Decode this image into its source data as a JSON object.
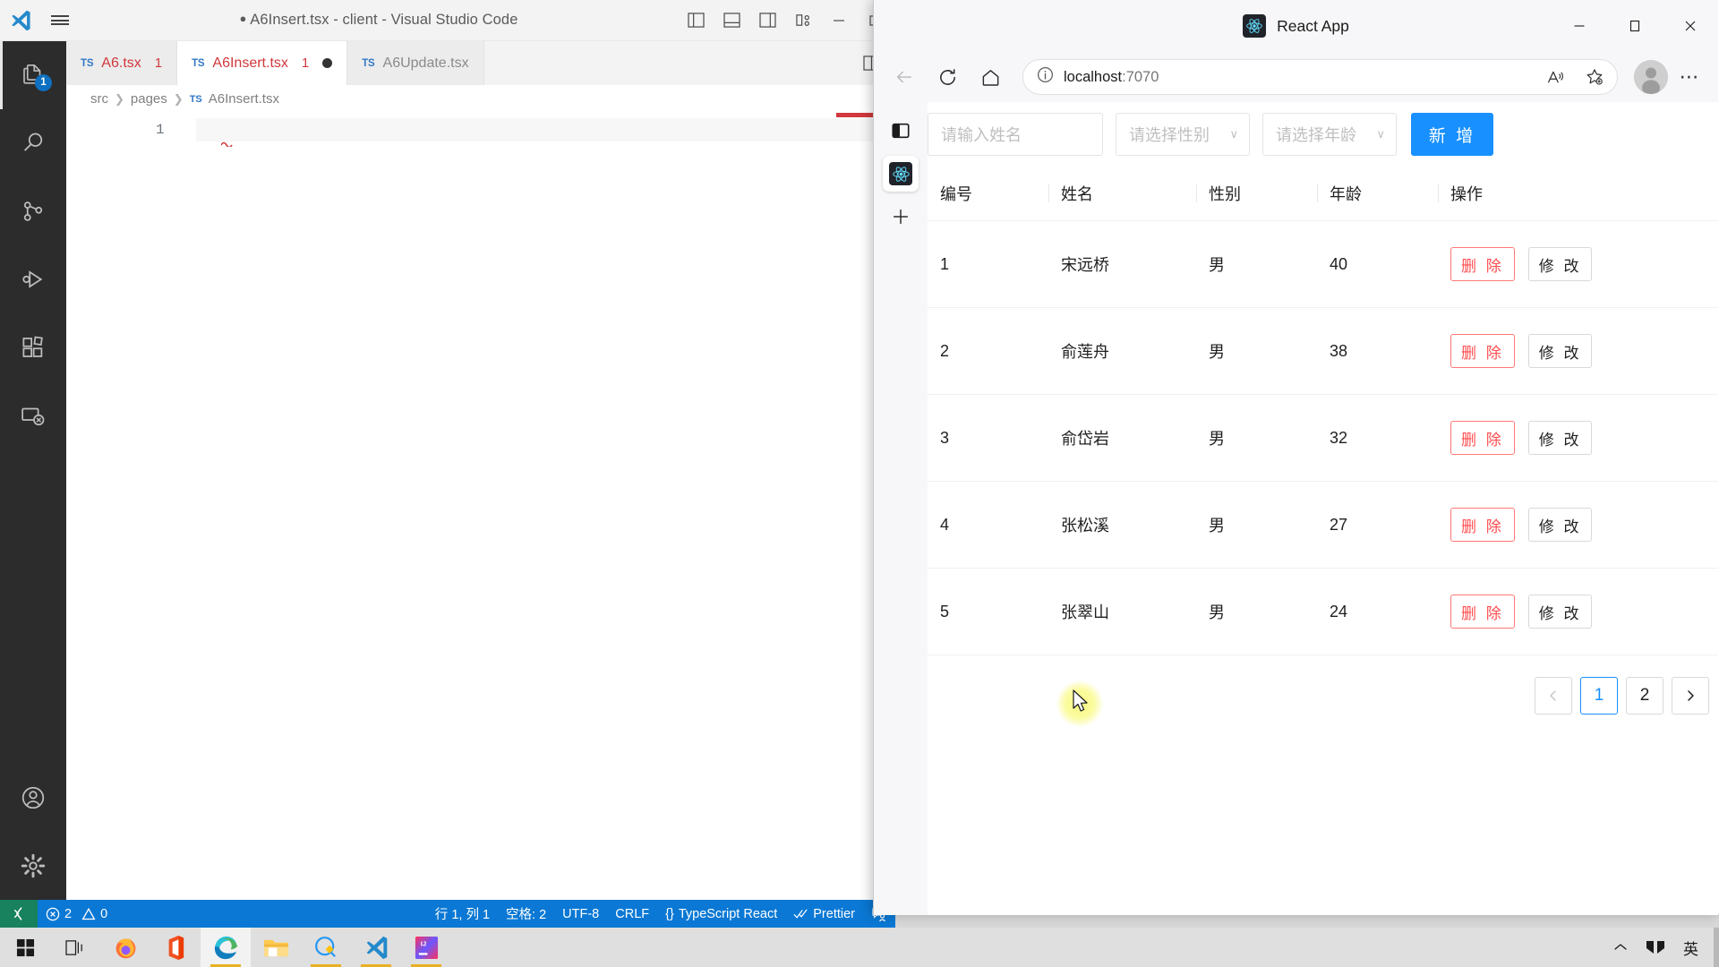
{
  "vscode": {
    "title_prefix": "●",
    "title": "A6Insert.tsx - client - Visual Studio Code",
    "logo_icon": "vscode-logo-icon",
    "menu_icon": "hamburger-menu-icon",
    "title_icons": [
      "toggle-primary-sidebar-icon",
      "toggle-panel-icon",
      "toggle-secondary-sidebar-icon",
      "customize-layout-icon"
    ],
    "window_buttons": [
      "minimize",
      "maximize",
      "close"
    ],
    "activity_bar": [
      {
        "name": "explorer",
        "icon": "files-icon",
        "badge": "1",
        "active": true
      },
      {
        "name": "search",
        "icon": "search-icon",
        "badge": "",
        "active": false
      },
      {
        "name": "source-control",
        "icon": "source-control-icon",
        "badge": "",
        "active": false
      },
      {
        "name": "run-and-debug",
        "icon": "run-debug-icon",
        "badge": "",
        "active": false
      },
      {
        "name": "extensions",
        "icon": "extensions-icon",
        "badge": "",
        "active": false
      },
      {
        "name": "remote-explorer",
        "icon": "remote-explorer-icon",
        "badge": "",
        "active": false
      }
    ],
    "activity_bottom": [
      {
        "name": "accounts",
        "icon": "account-icon"
      },
      {
        "name": "manage",
        "icon": "gear-icon"
      }
    ],
    "tabs": [
      {
        "ts_badge": "TS",
        "label": "A6.tsx",
        "error_count": "1",
        "modified": false,
        "active": false
      },
      {
        "ts_badge": "TS",
        "label": "A6Insert.tsx",
        "error_count": "1",
        "modified": true,
        "active": true
      },
      {
        "ts_badge": "TS",
        "label": "A6Update.tsx",
        "error_count": "",
        "modified": false,
        "active": false
      }
    ],
    "tabs_right_icon": "split-editor-icon",
    "breadcrumb": [
      "src",
      "pages",
      "A6Insert.tsx"
    ],
    "breadcrumb_ts_badge": "TS",
    "editor": {
      "line_number": "1",
      "content": ""
    },
    "status": {
      "remote_icon": "remote-window-icon",
      "errors_icon": "error-circle-icon",
      "errors": "2",
      "warnings_icon": "warning-triangle-icon",
      "warnings": "0",
      "cursor_position": "行 1, 列 1",
      "indentation": "空格: 2",
      "encoding": "UTF-8",
      "eol": "CRLF",
      "language_icon": "{}",
      "language": "TypeScript React",
      "formatter_icon": "checkmarks-icon",
      "formatter": "Prettier",
      "feedback_icon": "feedback-icon"
    }
  },
  "browser": {
    "tab_title": "React App",
    "favicon": "react-logo-icon",
    "window_buttons": {
      "minimize": "minimize-icon",
      "maximize": "maximize-icon",
      "close": "close-icon"
    },
    "nav": {
      "back_icon": "arrow-back-icon",
      "refresh_icon": "refresh-icon",
      "home_icon": "home-icon",
      "info_icon": "info-circle-icon",
      "url_host": "localhost",
      "url_port": ":7070",
      "read_aloud_icon": "read-aloud-icon",
      "favorite_icon": "add-favorite-star-icon",
      "profile_icon": "profile-avatar-icon",
      "settings_icon": "more-options-icon"
    },
    "sidebar": [
      {
        "name": "collapse-sidebar",
        "icon": "sidebar-panel-icon",
        "selected": false
      },
      {
        "name": "react-app-sidebar",
        "icon": "react-logo-icon",
        "selected": true
      },
      {
        "name": "add-sidebar-app",
        "icon": "plus-icon",
        "selected": false
      }
    ]
  },
  "app": {
    "form": {
      "name_placeholder": "请输入姓名",
      "gender_placeholder": "请选择性别",
      "age_placeholder": "请选择年龄",
      "add_button": "新 增",
      "caret_icon": "chevron-down-icon"
    },
    "table": {
      "columns": [
        "编号",
        "姓名",
        "性别",
        "年龄",
        "操作"
      ],
      "rows": [
        {
          "id": "1",
          "name": "宋远桥",
          "gender": "男",
          "age": "40",
          "delete": "删 除",
          "edit": "修 改"
        },
        {
          "id": "2",
          "name": "俞莲舟",
          "gender": "男",
          "age": "38",
          "delete": "删 除",
          "edit": "修 改"
        },
        {
          "id": "3",
          "name": "俞岱岩",
          "gender": "男",
          "age": "32",
          "delete": "删 除",
          "edit": "修 改"
        },
        {
          "id": "4",
          "name": "张松溪",
          "gender": "男",
          "age": "27",
          "delete": "删 除",
          "edit": "修 改"
        },
        {
          "id": "5",
          "name": "张翠山",
          "gender": "男",
          "age": "24",
          "delete": "删 除",
          "edit": "修 改"
        }
      ]
    },
    "pagination": {
      "prev_icon": "chevron-left-icon",
      "pages": [
        "1",
        "2"
      ],
      "current_page": "1",
      "next_icon": "chevron-right-icon"
    },
    "colors": {
      "primary": "#1890ff",
      "danger": "#ff4d4f",
      "border": "#f0f0f0"
    }
  },
  "taskbar": {
    "items": [
      {
        "name": "start",
        "icon": "windows-start-icon",
        "active": false,
        "running": false
      },
      {
        "name": "task-view",
        "icon": "task-view-icon",
        "active": false,
        "running": false
      },
      {
        "name": "firefox",
        "icon": "firefox-icon",
        "active": false,
        "running": false
      },
      {
        "name": "office",
        "icon": "office-icon",
        "active": false,
        "running": false
      },
      {
        "name": "microsoft-edge",
        "icon": "edge-icon",
        "active": true,
        "running": true
      },
      {
        "name": "file-explorer",
        "icon": "folder-icon",
        "active": false,
        "running": false
      },
      {
        "name": "wechat-dev",
        "icon": "wechat-devtools-icon",
        "active": false,
        "running": true
      },
      {
        "name": "visual-studio-code",
        "icon": "vscode-icon",
        "active": false,
        "running": true
      },
      {
        "name": "intellij-idea",
        "icon": "intellij-idea-icon",
        "active": false,
        "running": true
      }
    ],
    "tray": {
      "chevron_icon": "show-hidden-icons-icon",
      "network_icon": "network-icon",
      "ime": "英"
    }
  }
}
